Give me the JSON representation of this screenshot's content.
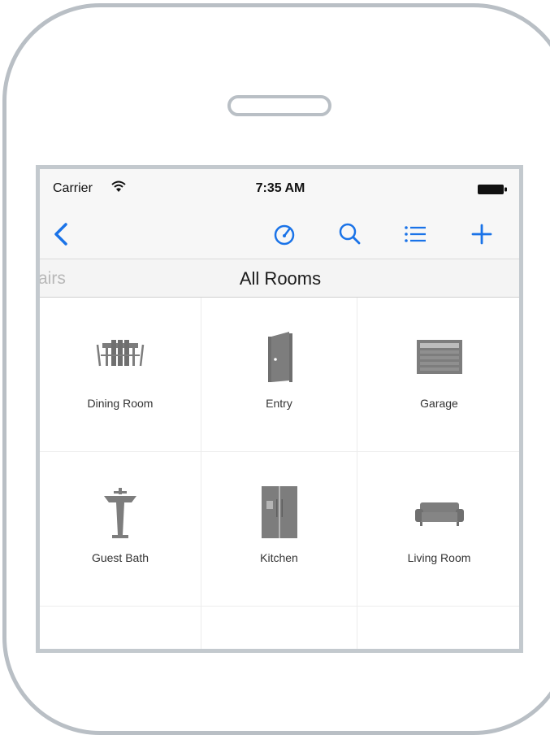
{
  "status_bar": {
    "carrier": "Carrier",
    "time": "7:35 AM",
    "icons": [
      "wifi-icon",
      "battery-icon"
    ]
  },
  "nav_bar": {
    "buttons": [
      {
        "name": "back-button",
        "icon": "chevron-left-icon"
      },
      {
        "name": "dashboard-button",
        "icon": "gauge-icon"
      },
      {
        "name": "search-button",
        "icon": "search-icon"
      },
      {
        "name": "list-button",
        "icon": "list-icon"
      },
      {
        "name": "add-button",
        "icon": "plus-icon"
      }
    ],
    "accent_color": "#1a73e8"
  },
  "sub_header": {
    "previous_title": "airs",
    "title": "All Rooms"
  },
  "rooms": [
    {
      "label": "Dining Room",
      "icon": "dining-table-icon"
    },
    {
      "label": "Entry",
      "icon": "door-icon"
    },
    {
      "label": "Garage",
      "icon": "garage-door-icon"
    },
    {
      "label": "Guest Bath",
      "icon": "pedestal-sink-icon"
    },
    {
      "label": "Kitchen",
      "icon": "refrigerator-icon"
    },
    {
      "label": "Living Room",
      "icon": "sofa-icon"
    },
    {
      "label": "",
      "icon": ""
    },
    {
      "label": "",
      "icon": ""
    },
    {
      "label": "",
      "icon": ""
    }
  ]
}
